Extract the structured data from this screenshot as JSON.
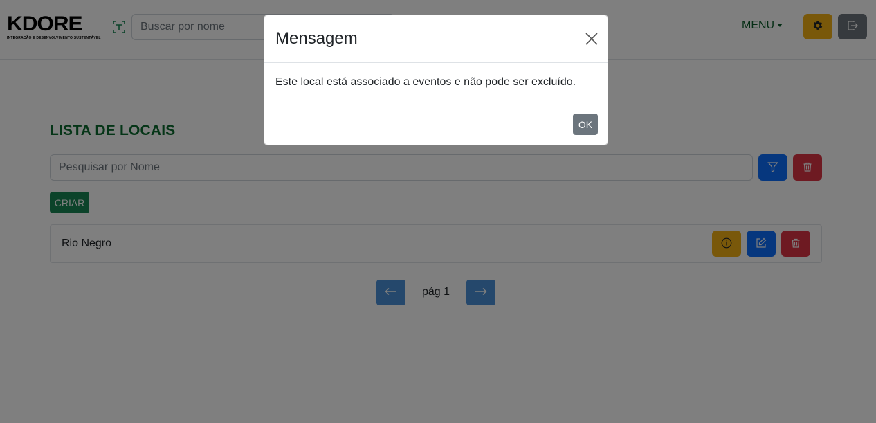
{
  "navbar": {
    "logo_text": "KDORE",
    "logo_subtitle": "INTEGRAÇÃO E DESENVOLVIMENTO SUSTENTÁVEL",
    "search_placeholder": "Buscar por nome",
    "menu_label": "MENU",
    "icons": {
      "scan": "scan-icon",
      "settings": "gear-icon",
      "logout": "logout-icon"
    }
  },
  "main": {
    "title": "LISTA DE LOCAIS",
    "search_placeholder": "Pesquisar por Nome",
    "create_label": "CRIAR",
    "items": [
      {
        "name": "Rio Negro"
      }
    ],
    "pagination": {
      "page_label": "pág 1"
    }
  },
  "modal": {
    "title": "Mensagem",
    "message": "Este local está associado a eventos e não pode ser excluído.",
    "ok_label": "OK"
  },
  "colors": {
    "brand_green": "#0b6b2e",
    "warning": "#f2b014",
    "primary": "#0d6efd",
    "danger": "#dc3545",
    "secondary": "#6c757d",
    "create_green": "#198754"
  }
}
